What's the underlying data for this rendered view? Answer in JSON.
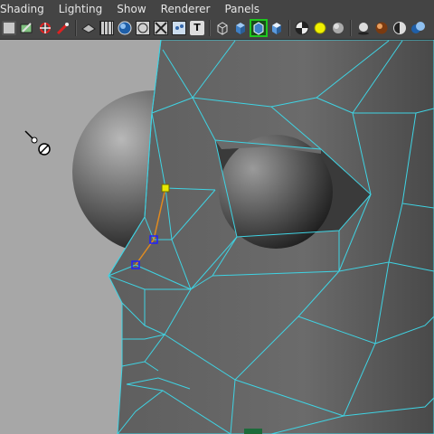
{
  "menubar": {
    "items": [
      {
        "label": "Shading"
      },
      {
        "label": "Lighting"
      },
      {
        "label": "Show"
      },
      {
        "label": "Renderer"
      },
      {
        "label": "Panels"
      }
    ]
  },
  "toolbar": {
    "icons": [
      "select-camera-icon",
      "camera-attributes-icon",
      "bookmarks-icon",
      "image-plane-icon",
      "wireframe-on-shaded-icon",
      "grid-icon",
      "smooth-shade-icon",
      "flat-shade-icon",
      "xray-icon",
      "isolate-icon",
      "texture-icon",
      "cube-wire-icon",
      "cube-shaded-icon",
      "frame-selection-icon",
      "cube-lit-icon",
      "checker-icon",
      "default-light-icon",
      "all-lights-icon",
      "shadows-icon",
      "material-ball-icon",
      "sphere-half-icon",
      "viewport-2-icon"
    ],
    "text_icon_label": "T",
    "active_icon": "frame-selection-icon"
  },
  "viewport": {
    "background": "#a7a7a7",
    "wireframe_color": "#3fd3e3",
    "selected_vertex_color": "#e8e800",
    "vertex_color": "#2020ff",
    "selected_edge_color": "#e08a20"
  }
}
